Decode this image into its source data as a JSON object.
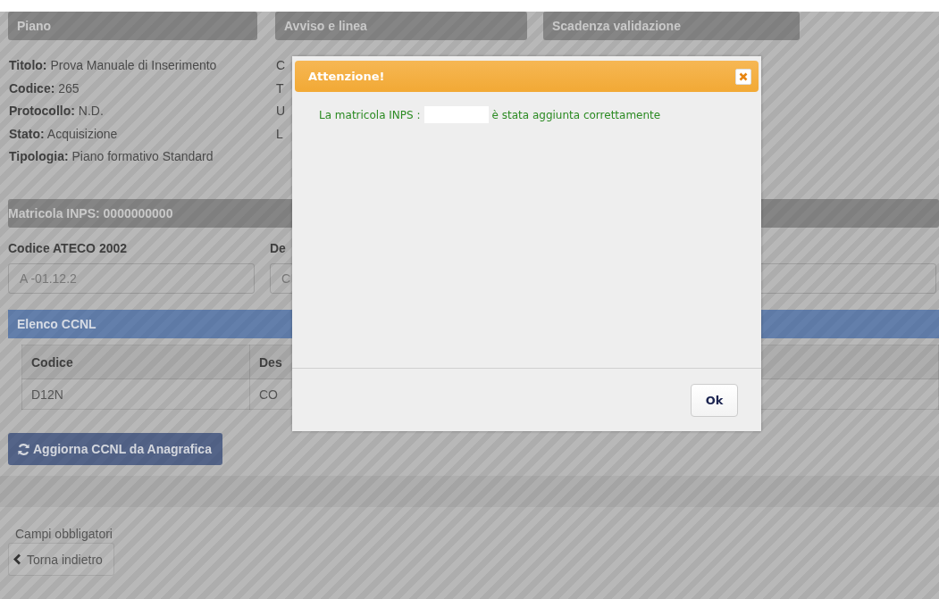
{
  "panels": [
    {
      "title": "Piano"
    },
    {
      "title": "Avviso e linea"
    },
    {
      "title": "Scadenza validazione"
    }
  ],
  "plan_details": [
    "**Titolo:** Prova Manuale di Inserimento",
    "**Codice:** 265",
    "**Protocollo:** N.D.",
    "**Stato:** Acquisizione",
    "**Tipologia:** Piano formativo Standard"
  ],
  "second_column_fragments": [
    "C",
    "T",
    "U",
    "L"
  ],
  "matricola_bar": {
    "title": "Matricola INPS: 0000000000"
  },
  "fields": [
    {
      "label": "Codice ATECO 2002",
      "value": "A -01.12.2"
    },
    {
      "label": "De",
      "value": "C"
    }
  ],
  "ccnl": {
    "title": "Elenco CCNL",
    "columns": [
      "Codice",
      "Des"
    ],
    "rows": [
      [
        "D12N",
        "CO"
      ]
    ]
  },
  "refresh_button": "Aggiorna CCNL da Anagrafica",
  "required_note": "Campi obbligatori",
  "back_button": "Torna indietro",
  "dialog": {
    "title": "Attenzione!",
    "message_before": "La matricola INPS :",
    "message_after": "è stata aggiunta correttamente",
    "ok_button": "Ok"
  }
}
